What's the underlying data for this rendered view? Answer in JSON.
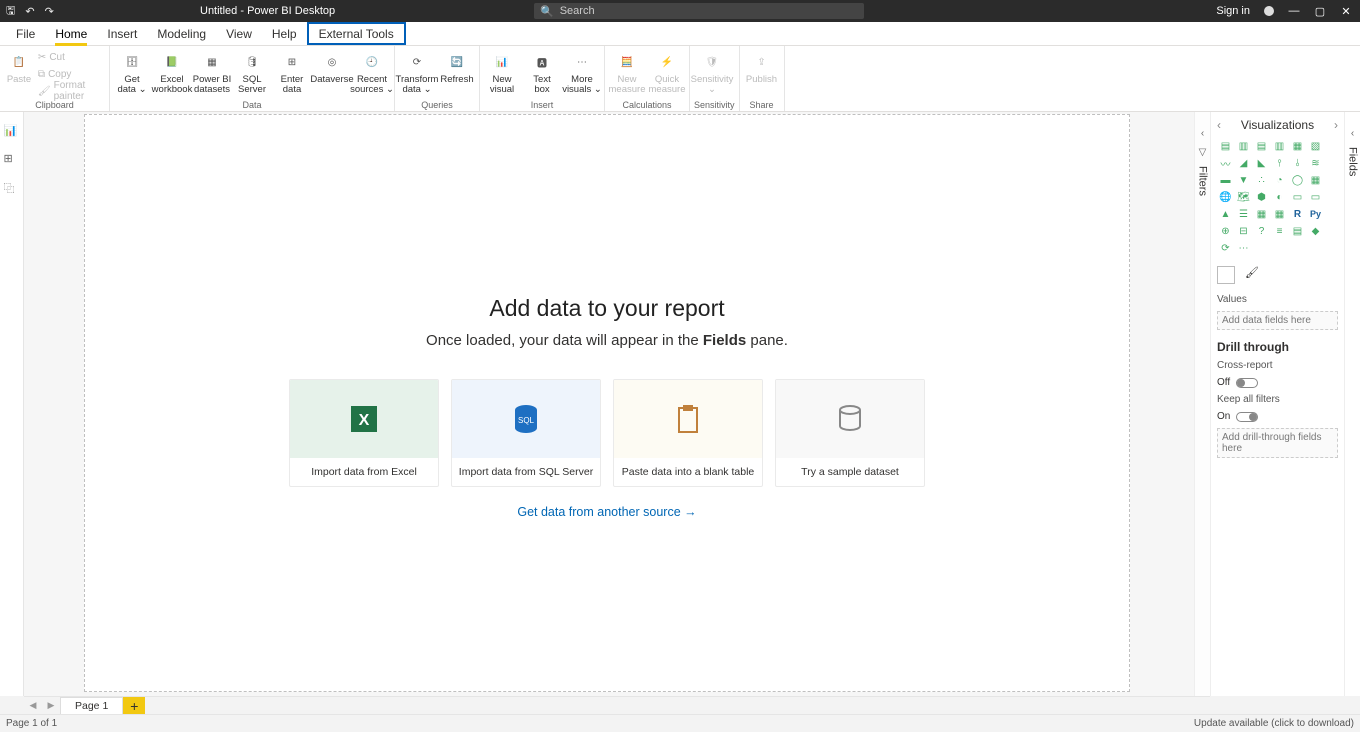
{
  "titlebar": {
    "title": "Untitled - Power BI Desktop",
    "search_placeholder": "Search",
    "signin": "Sign in"
  },
  "menu": {
    "file": "File",
    "home": "Home",
    "insert": "Insert",
    "modeling": "Modeling",
    "view": "View",
    "help": "Help",
    "external": "External Tools"
  },
  "ribbon": {
    "clipboard": {
      "label": "Clipboard",
      "paste": "Paste",
      "cut": "Cut",
      "copy": "Copy",
      "format_painter": "Format painter"
    },
    "data": {
      "label": "Data",
      "get_data": "Get\ndata ⌄",
      "excel": "Excel\nworkbook",
      "pbids": "Power BI\ndatasets",
      "sql": "SQL\nServer",
      "enter": "Enter\ndata",
      "dataverse": "Dataverse",
      "recent": "Recent\nsources ⌄"
    },
    "queries": {
      "label": "Queries",
      "transform": "Transform\ndata ⌄",
      "refresh": "Refresh"
    },
    "insert": {
      "label": "Insert",
      "new_visual": "New\nvisual",
      "text_box": "Text\nbox",
      "more_visuals": "More\nvisuals ⌄"
    },
    "calc": {
      "label": "Calculations",
      "new_measure": "New\nmeasure",
      "quick_measure": "Quick\nmeasure"
    },
    "sensitivity": {
      "label": "Sensitivity",
      "btn": "Sensitivity\n⌄"
    },
    "share": {
      "label": "Share",
      "publish": "Publish"
    }
  },
  "canvas": {
    "heading": "Add data to your report",
    "sub_pre": "Once loaded, your data will appear in the ",
    "sub_bold": "Fields",
    "sub_post": " pane.",
    "cards": {
      "excel": "Import data from Excel",
      "sql": "Import data from SQL Server",
      "paste": "Paste data into a blank table",
      "sample": "Try a sample dataset"
    },
    "link": "Get data from another source →"
  },
  "panes": {
    "filters": "Filters",
    "visualizations": "Visualizations",
    "values": "Values",
    "values_well": "Add data fields here",
    "drill": "Drill through",
    "cross_report": "Cross-report",
    "off": "Off",
    "keep_filters": "Keep all filters",
    "on": "On",
    "drill_well": "Add drill-through fields here",
    "fields": "Fields"
  },
  "pagetabs": {
    "page1": "Page 1",
    "add": "+"
  },
  "status": {
    "left": "Page 1 of 1",
    "right": "Update available (click to download)"
  }
}
